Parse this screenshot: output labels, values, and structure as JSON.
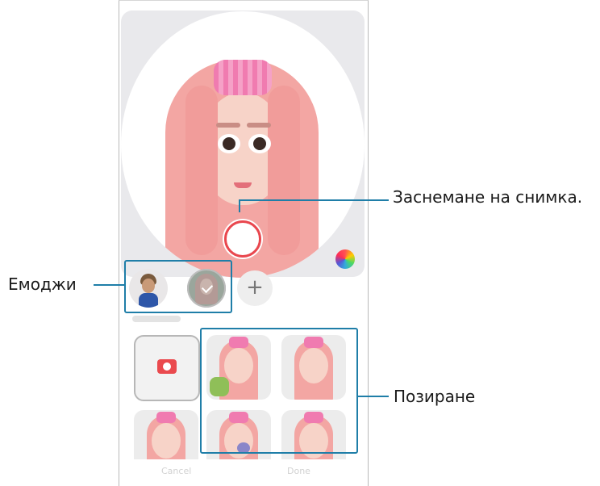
{
  "callouts": {
    "capture": "Заснемане на снимка.",
    "emoji": "Емоджи",
    "pose": "Позиране"
  },
  "emoji_bar": {
    "add": "+"
  },
  "bottom": {
    "cancel": "Cancel",
    "done": "Done"
  },
  "colors": {
    "capture_ring": "#e9474e",
    "callout": "#1f7ea8",
    "camera_icon": "#ea4a4e",
    "hair": "#f3a6a3"
  },
  "icons": [
    "color-palette-icon",
    "camera-icon",
    "plus-icon"
  ]
}
